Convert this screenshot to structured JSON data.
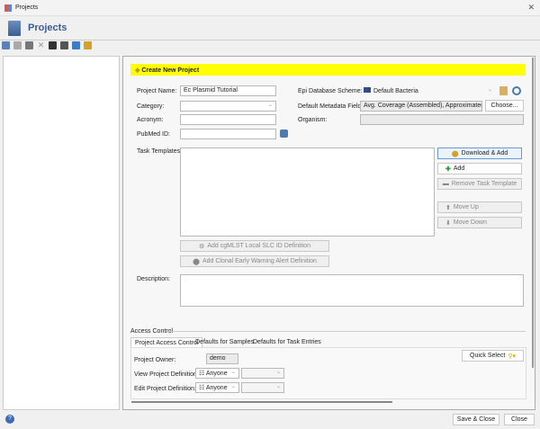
{
  "window": {
    "title": "Projects"
  },
  "header": {
    "title": "Projects"
  },
  "toolbar": {
    "icons": [
      "new-project-icon",
      "grid-icon",
      "save-icon",
      "delete-icon",
      "group-icon",
      "ungroup-icon",
      "upload-icon",
      "settings-icon"
    ]
  },
  "form": {
    "banner": "Create New Project",
    "project_name_label": "Project Name:",
    "project_name": "Ec Plasmid Tutorial",
    "category_label": "Category:",
    "category": "",
    "acronym_label": "Acronym:",
    "acronym": "",
    "pubmed_label": "PubMed ID:",
    "pubmed": "",
    "epi_label": "Epi Database Scheme:",
    "epi": "Default Bacteria",
    "metadata_label": "Default Metadata Fields:",
    "metadata": "Avg. Coverage (Assembled), Approximated Ger",
    "choose": "Choose...",
    "organism_label": "Organism:",
    "organism": "",
    "task_templates_label": "Task Templates:",
    "download_add": "Download & Add",
    "add": "Add",
    "remove": "Remove Task Template",
    "move_up": "Move Up",
    "move_down": "Move Down",
    "add_cgmlst": "Add cgMLST Local SLC ID Definition",
    "add_clonal": "Add Clonal Early Warning Alert Definition",
    "description_label": "Description:",
    "description": ""
  },
  "access": {
    "title": "Access Control",
    "tabs": [
      "Project Access Control",
      "Defaults for Samples",
      "Defaults for Task Entries"
    ],
    "owner_label": "Project Owner:",
    "owner": "demo",
    "view_label": "View Project Definition:",
    "view": "Anyone",
    "edit_label": "Edit Project Definition:",
    "edit": "Anyone",
    "quick_select": "Quick Select"
  },
  "footer": {
    "save_close": "Save & Close",
    "close": "Close"
  },
  "colors": {
    "banner": "#ffff00",
    "title": "#3a5a9a"
  }
}
